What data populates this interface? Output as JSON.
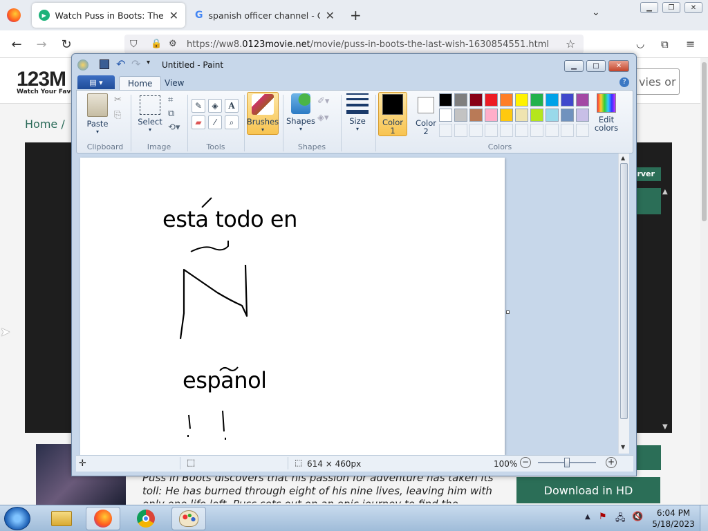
{
  "browser": {
    "tabs": [
      {
        "title": "Watch Puss in Boots: The Last W"
      },
      {
        "title": "spanish officer channel - Googl"
      }
    ],
    "url_prefix": "https://ww8.",
    "url_domain": "0123movie.net",
    "url_path": "/movie/puss-in-boots-the-last-wish-1630854551.html"
  },
  "site": {
    "logo": "123M",
    "tagline": "Watch Your Favor",
    "search_placeholder": "vies or",
    "breadcrumb": "Home  /",
    "server_label": "erver",
    "synopsis": "Puss in Boots discovers that his passion for adventure has taken its toll: He has burned through eight of his nine lives, leaving him with only one life left. Puss sets out on an epic journey to find the mythical Last Wish and",
    "download_label": "Download in HD"
  },
  "paint": {
    "title": "Untitled - Paint",
    "tabs": [
      "Home",
      "View"
    ],
    "groups": {
      "clipboard": "Clipboard",
      "image": "Image",
      "tools": "Tools",
      "shapes": "Shapes",
      "colors": "Colors"
    },
    "buttons": {
      "paste": "Paste",
      "select": "Select",
      "brushes": "Brushes",
      "shapes": "Shapes",
      "size": "Size",
      "color1_line1": "Color",
      "color1_line2": "1",
      "color2_line1": "Color",
      "color2_line2": "2",
      "edit_colors_line1": "Edit",
      "edit_colors_line2": "colors"
    },
    "canvas_text": {
      "line1": "esta todo en",
      "line2": "espanol"
    },
    "status": {
      "canvas_size": "614 × 460px",
      "zoom": "100%"
    },
    "palette_row1": [
      "#000000",
      "#7f7f7f",
      "#880015",
      "#ed1c24",
      "#ff7f27",
      "#fff200",
      "#22b14c",
      "#00a2e8",
      "#3f48cc",
      "#a349a4"
    ],
    "palette_row2": [
      "#ffffff",
      "#c3c3c3",
      "#b97a57",
      "#ffaec9",
      "#ffc90e",
      "#efe4b0",
      "#b5e61d",
      "#99d9ea",
      "#7092be",
      "#c8bfe7"
    ],
    "color1": "#000000",
    "color2": "#ffffff"
  },
  "taskbar": {
    "time": "6:04 PM",
    "date": "5/18/2023"
  }
}
